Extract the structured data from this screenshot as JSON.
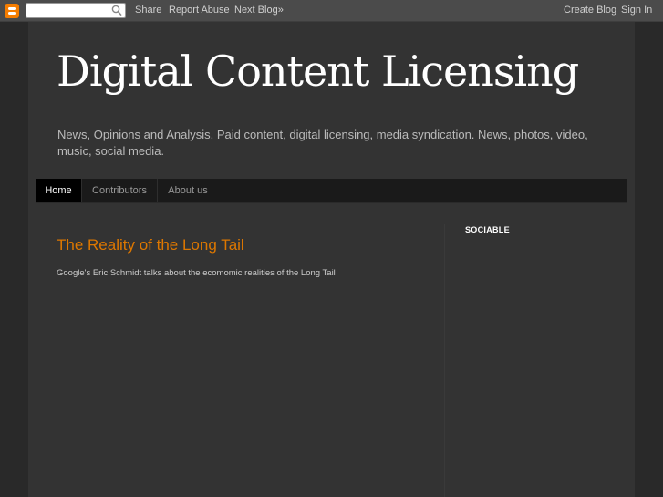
{
  "navbar": {
    "search_placeholder": "",
    "share": "Share",
    "report_abuse": "Report Abuse",
    "next_blog": "Next Blog»",
    "create_blog": "Create Blog",
    "sign_in": "Sign In"
  },
  "header": {
    "title": "Digital Content Licensing",
    "description": "News, Opinions and Analysis. Paid content, digital licensing, media syndication. News, photos, video, music, social media."
  },
  "tabs": [
    {
      "label": "Home",
      "active": true
    },
    {
      "label": "Contributors",
      "active": false
    },
    {
      "label": "About us",
      "active": false
    }
  ],
  "post": {
    "title": "The Reality of the Long Tail",
    "body": "Google's Eric Schmidt talks about the ecomomic realities of the Long Tail"
  },
  "sidebar": {
    "heading": "SOCIABLE"
  },
  "colors": {
    "accent": "#dd7700",
    "background": "#292929",
    "content_background": "#333333",
    "tab_active": "#000000"
  },
  "icons": {
    "logo": "blogger-logo-icon",
    "search": "search-icon"
  }
}
